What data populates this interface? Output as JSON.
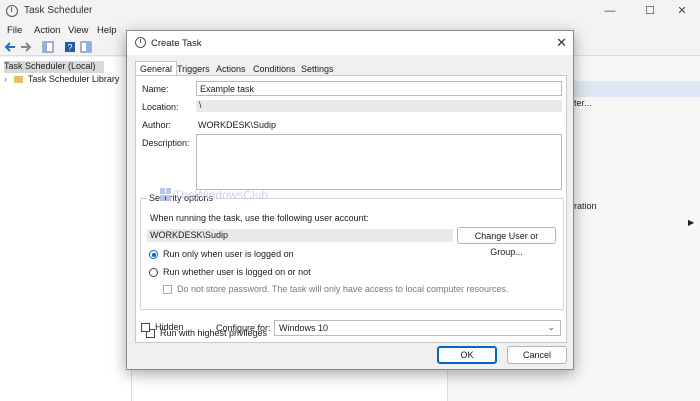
{
  "main": {
    "title": "Task Scheduler",
    "menu": [
      "File",
      "Action",
      "View",
      "Help"
    ],
    "tree": {
      "root": "Task Scheduler (Local)",
      "library": "Task Scheduler Library"
    },
    "right_pane": {
      "partial_item1": "iter...",
      "partial_item2": "iration"
    },
    "window_controls": {
      "minimize": "—",
      "maximize": "☐",
      "close": "✕"
    }
  },
  "dialog": {
    "title": "Create Task",
    "close": "✕",
    "tabs": [
      "General",
      "Triggers",
      "Actions",
      "Conditions",
      "Settings"
    ],
    "name_label": "Name:",
    "name_value": "Example task",
    "location_label": "Location:",
    "location_value": "\\",
    "author_label": "Author:",
    "author_value": "WORKDESK\\Sudip",
    "description_label": "Description:",
    "description_value": "",
    "security": {
      "title": "Security options",
      "prompt": "When running the task, use the following user account:",
      "account": "WORKDESK\\Sudip",
      "change_button": "Change User or Group...",
      "opt_logged_on": "Run only when user is logged on",
      "opt_whether": "Run whether user is logged on or not",
      "opt_no_store": "Do not store password.  The task will only have access to local computer resources.",
      "opt_highest": "Run with highest privileges"
    },
    "hidden_label": "Hidden",
    "configure_label": "Configure for:",
    "configure_value": "Windows 10",
    "ok": "OK",
    "cancel": "Cancel"
  },
  "watermark": "TheWindowsClub",
  "colors": {
    "accent": "#0067c0",
    "watermark": "#c9d2e6"
  }
}
